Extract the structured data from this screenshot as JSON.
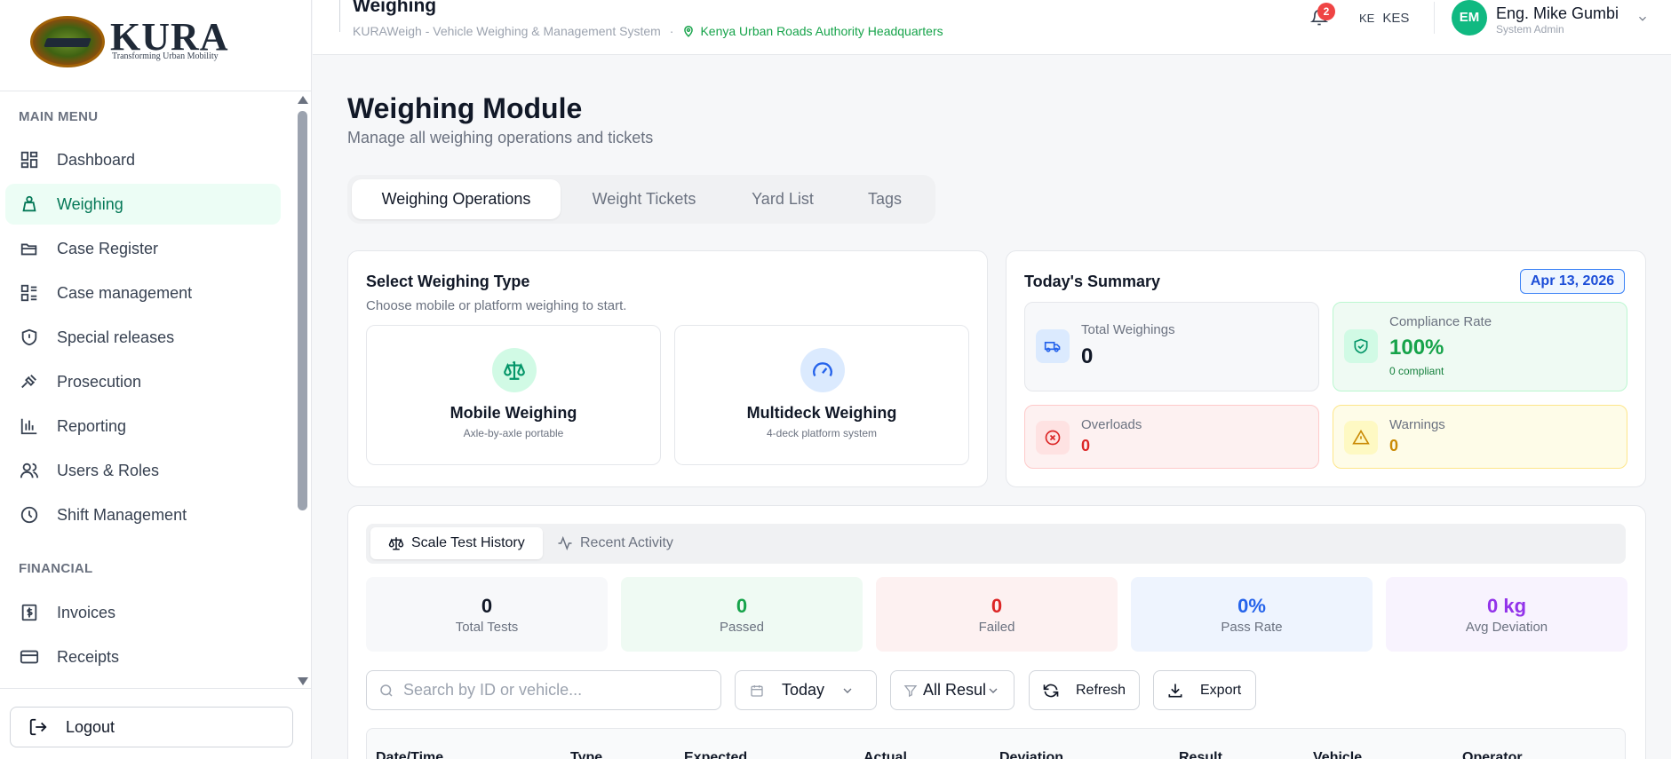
{
  "brand": {
    "name": "KURA",
    "tagline": "Transforming Urban Mobility"
  },
  "sidebar": {
    "main_menu_label": "MAIN MENU",
    "items": [
      {
        "label": "Dashboard",
        "icon": "dashboard-icon"
      },
      {
        "label": "Weighing",
        "icon": "weight-icon",
        "active": true
      },
      {
        "label": "Case Register",
        "icon": "folder-open-icon"
      },
      {
        "label": "Case management",
        "icon": "list-icon"
      },
      {
        "label": "Special releases",
        "icon": "shield-icon"
      },
      {
        "label": "Prosecution",
        "icon": "gavel-icon"
      },
      {
        "label": "Reporting",
        "icon": "bar-chart-icon"
      },
      {
        "label": "Users & Roles",
        "icon": "users-icon"
      },
      {
        "label": "Shift Management",
        "icon": "clock-icon"
      }
    ],
    "financial_label": "FINANCIAL",
    "financial_items": [
      {
        "label": "Invoices",
        "icon": "dollar-document-icon"
      },
      {
        "label": "Receipts",
        "icon": "credit-card-icon"
      }
    ],
    "logout_label": "Logout"
  },
  "header": {
    "title": "Weighing",
    "system": "KURAWeigh - Vehicle Weighing & Management System",
    "separator": "·",
    "location": "Kenya Urban Roads Authority Headquarters",
    "notifications": "2",
    "lang_flag": "KE",
    "currency": "KES",
    "user_initials": "EM",
    "user_name": "Eng. Mike Gumbi",
    "user_role": "System Admin"
  },
  "page": {
    "title": "Weighing Module",
    "subtitle": "Manage all weighing operations and tickets",
    "tabs": [
      "Weighing Operations",
      "Weight Tickets",
      "Yard List",
      "Tags"
    ]
  },
  "weighing_type": {
    "title": "Select Weighing Type",
    "subtitle": "Choose mobile or platform weighing to start.",
    "options": [
      {
        "label": "Mobile Weighing",
        "desc": "Axle-by-axle portable"
      },
      {
        "label": "Multideck Weighing",
        "desc": "4-deck platform system"
      }
    ]
  },
  "summary": {
    "title": "Today's Summary",
    "date": "Apr 13, 2026",
    "total_label": "Total Weighings",
    "total_value": "0",
    "compliance_label": "Compliance Rate",
    "compliance_value": "100%",
    "compliance_sub": "0 compliant",
    "overloads_label": "Overloads",
    "overloads_value": "0",
    "warnings_label": "Warnings",
    "warnings_value": "0"
  },
  "history": {
    "subtabs": [
      "Scale Test History",
      "Recent Activity"
    ],
    "kpis": [
      {
        "value": "0",
        "label": "Total Tests",
        "color": "#111827",
        "bg": "#f7f8fa"
      },
      {
        "value": "0",
        "label": "Passed",
        "color": "#16a34a",
        "bg": "#effaf3"
      },
      {
        "value": "0",
        "label": "Failed",
        "color": "#dc2626",
        "bg": "#fdf1f1"
      },
      {
        "value": "0%",
        "label": "Pass Rate",
        "color": "#2563eb",
        "bg": "#eef4fe"
      },
      {
        "value": "0 kg",
        "label": "Avg Deviation",
        "color": "#9333ea",
        "bg": "#f8f3fe"
      }
    ],
    "search_placeholder": "Search by ID or vehicle...",
    "date_filter": "Today",
    "result_filter": "All Resul",
    "refresh_label": "Refresh",
    "export_label": "Export",
    "columns": [
      "Date/Time",
      "Type",
      "Expected",
      "Actual",
      "Deviation",
      "Result",
      "Vehicle",
      "Operator"
    ]
  }
}
